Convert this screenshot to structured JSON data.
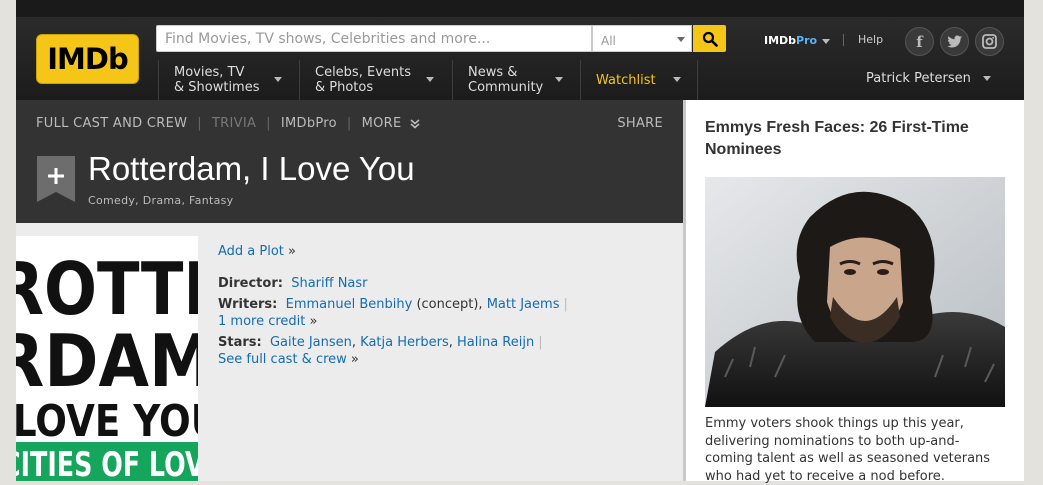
{
  "header": {
    "logo": "IMDb",
    "search_placeholder": "Find Movies, TV shows, Celebrities and more...",
    "category": "All",
    "pro_label": "IMDb",
    "pro_suffix": "Pro",
    "help": "Help",
    "nav": [
      {
        "line1": "Movies, TV",
        "line2": "& Showtimes"
      },
      {
        "line1": "Celebs, Events",
        "line2": "& Photos"
      },
      {
        "line1": "News &",
        "line2": "Community"
      },
      {
        "line1": "Watchlist",
        "line2": ""
      }
    ],
    "user": "Patrick Petersen",
    "social_icons": [
      "facebook-icon",
      "twitter-icon",
      "instagram-icon"
    ],
    "accent": "#f5c518"
  },
  "subnav": {
    "full_cast": "FULL CAST AND CREW",
    "trivia": "TRIVIA",
    "imdbpro": "IMDbPro",
    "more": "MORE",
    "share": "SHARE"
  },
  "title": {
    "name": "Rotterdam, I Love You",
    "genres": "Comedy, Drama, Fantasy"
  },
  "poster_lines": [
    "ROTTE",
    "RDAM",
    "I LOVE YOU",
    "CITIES OF LOVE"
  ],
  "details": {
    "add_plot": "Add a Plot",
    "director_label": "Director:",
    "director": "Shariff Nasr",
    "writers_label": "Writers:",
    "writer1": "Emmanuel Benbihy",
    "writer1_note": "(concept),",
    "writer2": "Matt Jaems",
    "more_credit": "1 more credit",
    "stars_label": "Stars:",
    "star1": "Gaite Jansen",
    "star2": "Katja Herbers",
    "star3": "Halina Reijn",
    "full_cast": "See full cast & crew"
  },
  "sidebar": {
    "title": "Emmys Fresh Faces: 26 First-Time Nominees",
    "text": "Emmy voters shook things up this year, delivering nominations to both up-and-coming talent as well as seasoned veterans who had yet to receive a nod before."
  }
}
